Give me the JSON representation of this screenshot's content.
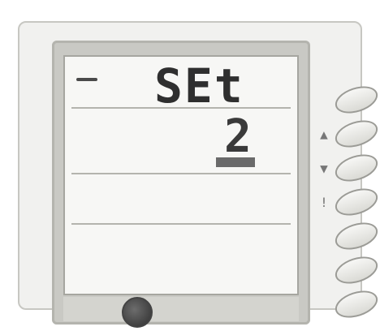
{
  "display": {
    "mode_text": "SEt",
    "value_text": "2"
  },
  "buttons": [
    {
      "symbol": ""
    },
    {
      "symbol": "▲"
    },
    {
      "symbol": "▼"
    },
    {
      "symbol": "!"
    },
    {
      "symbol": ""
    },
    {
      "symbol": ""
    },
    {
      "symbol": ""
    }
  ],
  "colors": {
    "device_bg": "#f1f1ef",
    "screen_bg": "#f7f7f5",
    "text_dark": "#2f2f2f"
  }
}
